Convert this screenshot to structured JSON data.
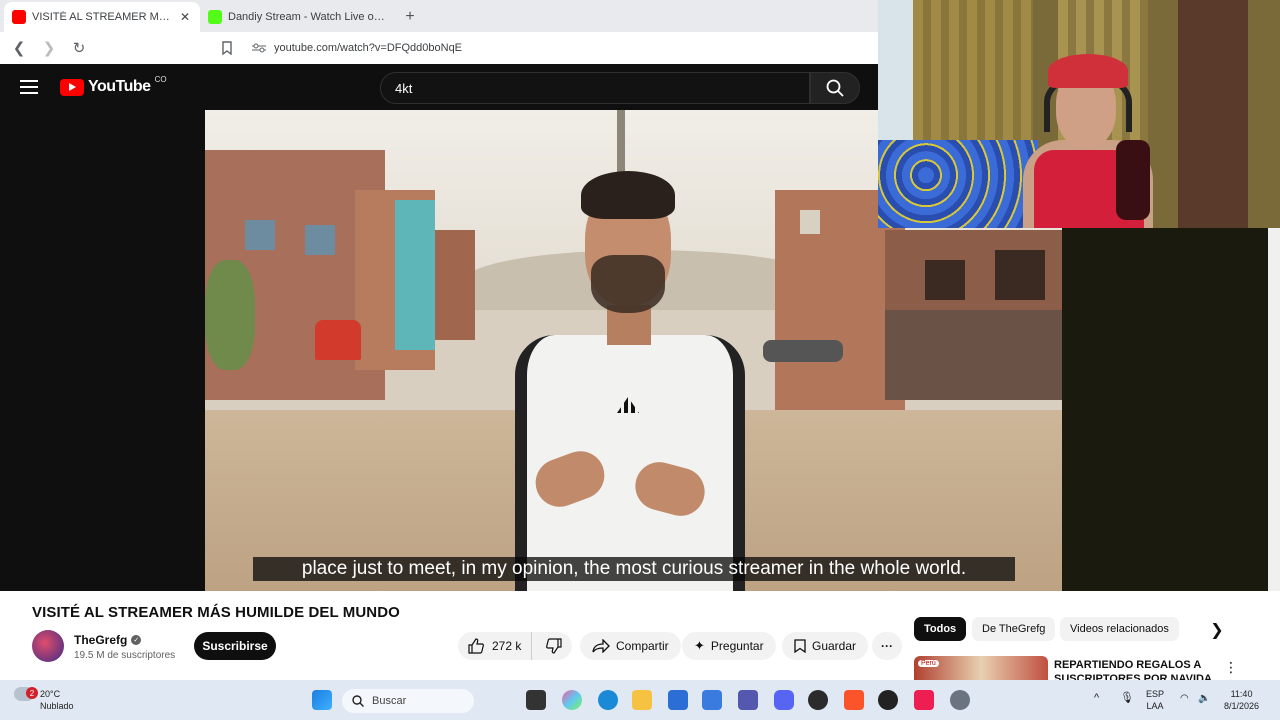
{
  "browser": {
    "tabs": [
      {
        "title": "VISITÉ AL STREAMER MÁS HUMI",
        "active": true,
        "favicon_color": "#ff0000"
      },
      {
        "title": "Dandiy Stream - Watch Live on Kick",
        "active": false,
        "favicon_color": "#53fc18"
      }
    ],
    "url": "youtube.com/watch?v=DFQdd0boNqE"
  },
  "youtube": {
    "logo_text": "YouTube",
    "country_code": "CO",
    "search_query": "4kt",
    "subtitle": "place just to meet, in my opinion, the most curious streamer in the whole world.",
    "video_title": "VISITÉ AL STREAMER MÁS HUMILDE DEL MUNDO",
    "channel_name": "TheGrefg",
    "subscribers": "19.5 M de suscriptores",
    "subscribe_label": "Suscribirse",
    "likes": "272 k",
    "share_label": "Compartir",
    "ask_label": "Preguntar",
    "save_label": "Guardar",
    "chips": [
      "Todos",
      "De TheGrefg",
      "Videos relacionados"
    ],
    "related": {
      "title": "REPARTIENDO REGALOS A SUSCRIPTORES POR NAVIDA",
      "thumb_label": "Perú"
    }
  },
  "taskbar": {
    "weather_temp": "20°C",
    "weather_desc": "Nublado",
    "weather_badge": "2",
    "search_label": "Buscar",
    "lang_top": "ESP",
    "lang_bottom": "LAA",
    "time": "11:40",
    "date": "8/1/2026"
  },
  "colors": {
    "accent": "#ff0000",
    "dark": "#0f0f0f"
  }
}
